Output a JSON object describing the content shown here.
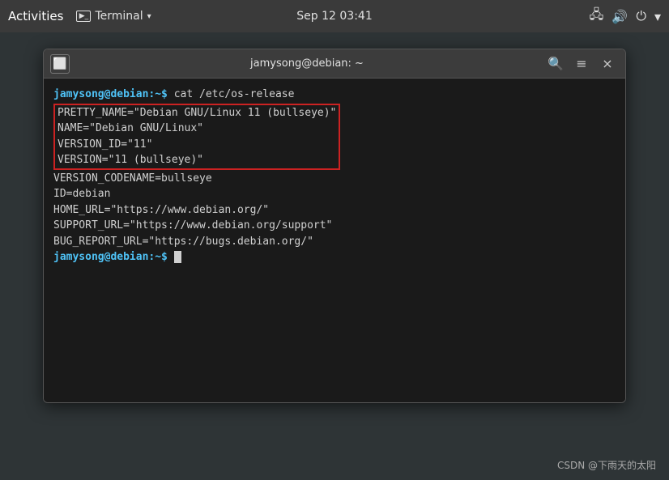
{
  "topbar": {
    "activities_label": "Activities",
    "terminal_label": "Terminal",
    "datetime": "Sep 12  03:41"
  },
  "window": {
    "title": "jamysong@debian: ~",
    "close_label": "×",
    "menu_label": "≡",
    "search_label": "🔍"
  },
  "terminal": {
    "prompt1": "jamysong@debian:~$",
    "command1": " cat /etc/os-release",
    "line1": "PRETTY_NAME=\"Debian GNU/Linux 11 (bullseye)\"",
    "line2": "NAME=\"Debian GNU/Linux\"",
    "line3": "VERSION_ID=\"11\"",
    "line4": "VERSION=\"11 (bullseye)\"",
    "line5": "VERSION_CODENAME=bullseye",
    "line6": "ID=debian",
    "line7": "HOME_URL=\"https://www.debian.org/\"",
    "line8": "SUPPORT_URL=\"https://www.debian.org/support\"",
    "line9": "BUG_REPORT_URL=\"https://bugs.debian.org/\"",
    "prompt2": "jamysong@debian:~$"
  },
  "watermark": {
    "text": "CSDN @下雨天的太阳"
  }
}
